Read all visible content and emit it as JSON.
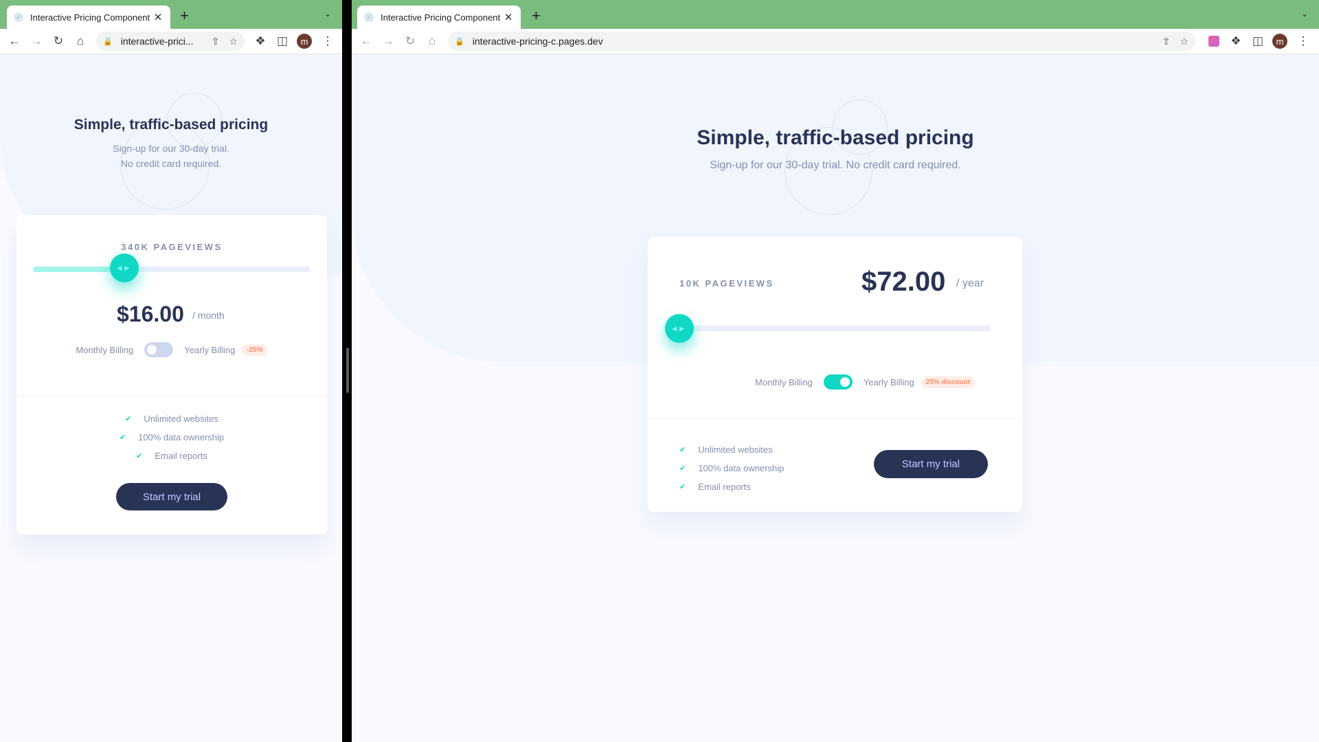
{
  "left_window": {
    "tab_title": "Interactive Pricing Component",
    "url": "interactive-prici...",
    "page": {
      "title": "Simple, traffic-based pricing",
      "subtitle_line1": "Sign-up for our 30-day trial.",
      "subtitle_line2": "No credit card required.",
      "pageviews": "340K PAGEVIEWS",
      "slider_fraction": 0.33,
      "price": "$16.00",
      "period": "/ month",
      "monthly_label": "Monthly Billing",
      "yearly_label": "Yearly Billing",
      "discount": "-25%",
      "yearly_on": false,
      "features": [
        "Unlimited websites",
        "100% data ownership",
        "Email reports"
      ],
      "cta": "Start my trial"
    }
  },
  "right_window": {
    "tab_title": "Interactive Pricing Component",
    "url": "interactive-pricing-c.pages.dev",
    "page": {
      "title": "Simple, traffic-based pricing",
      "subtitle": "Sign-up for our 30-day trial. No credit card required.",
      "pageviews": "10K PAGEVIEWS",
      "slider_fraction": 0.0,
      "price": "$72.00",
      "period": "/ year",
      "monthly_label": "Monthly Billing",
      "yearly_label": "Yearly Billing",
      "discount": "25% discount",
      "yearly_on": true,
      "features": [
        "Unlimited websites",
        "100% data ownership",
        "Email reports"
      ],
      "cta": "Start my trial"
    }
  },
  "chrome": {
    "avatar_letter": "m",
    "tab_color": "#7abc7e"
  },
  "colors": {
    "primary": "#10d8c4",
    "dark": "#293356",
    "muted": "#858fad",
    "toggle_off": "#cdd7ee",
    "badge_bg": "#feece7",
    "badge_text": "#ff8c66"
  },
  "icons": {
    "back": "arrow-left-icon",
    "forward": "arrow-right-icon",
    "reload": "reload-icon",
    "home": "home-icon",
    "lock": "lock-icon",
    "share": "share-icon",
    "star": "star-icon",
    "extensions": "puzzle-icon",
    "sidepanel": "sidepanel-icon",
    "menu": "kebab-menu-icon",
    "check": "check-icon"
  }
}
